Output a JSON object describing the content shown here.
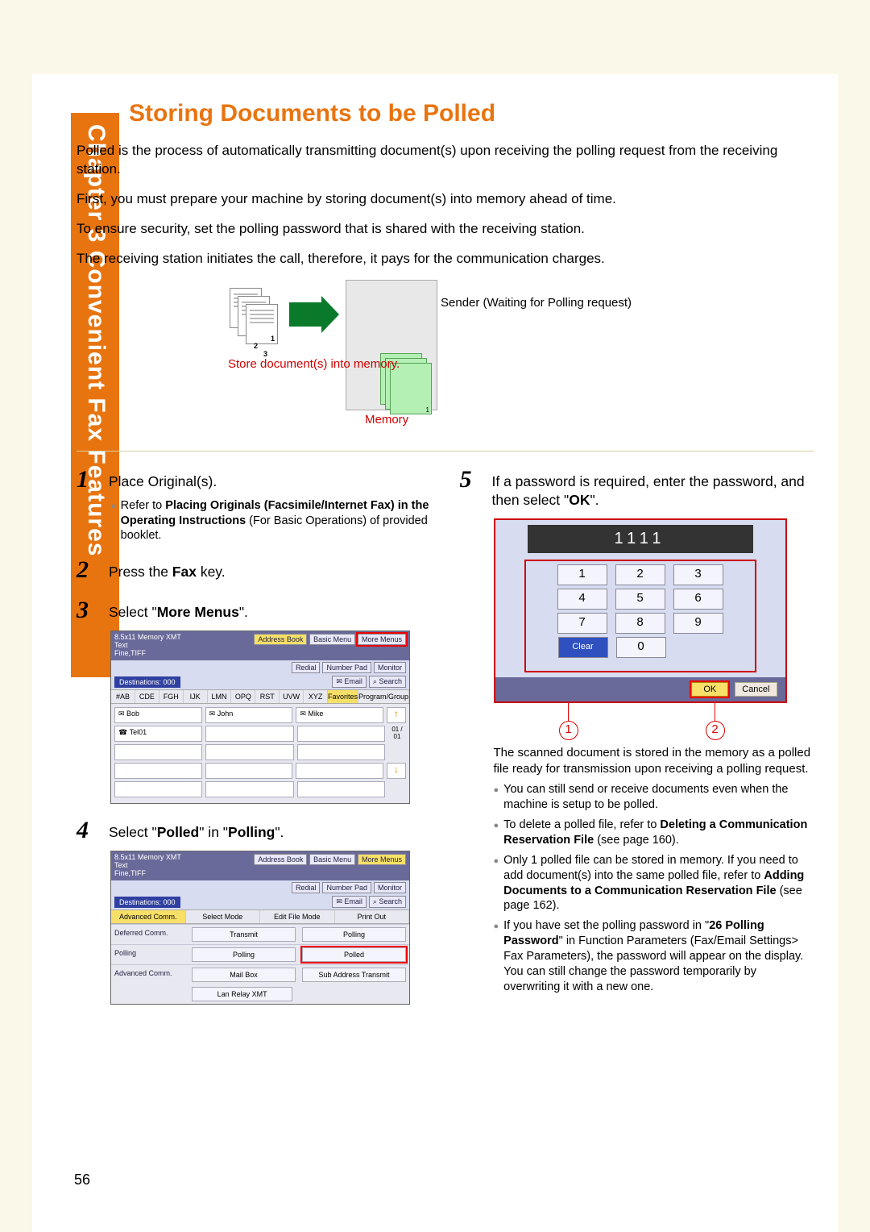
{
  "chapter": "Chapter 3   Convenient Fax Features",
  "title": "Storing Documents to be Polled",
  "intro": {
    "p1": "Polled is the process of automatically transmitting document(s) upon receiving the polling request from the receiving station.",
    "p2": "First, you must prepare your machine by storing document(s) into memory ahead of time.",
    "p3": "To ensure security, set the polling password that is shared with the receiving station.",
    "p4": "The receiving station initiates the call, therefore, it pays for the communication charges."
  },
  "diagram": {
    "store": "Store document(s) into memory.",
    "memory": "Memory",
    "sender": "Sender (Waiting for Polling request)",
    "nums": [
      "1",
      "2",
      "3"
    ]
  },
  "steps": {
    "s1": {
      "num": "1",
      "text": "Place Original(s).",
      "note_pre": "Refer to ",
      "note_bold1": "Placing Originals (Facsimile/Internet Fax) in the Operating Instructions",
      "note_post": " (For Basic Operations) of provided booklet."
    },
    "s2": {
      "num": "2",
      "text_pre": "Press the ",
      "text_bold": "Fax",
      "text_post": " key."
    },
    "s3": {
      "num": "3",
      "text_pre": "Select \"",
      "text_bold": "More Menus",
      "text_post": "\"."
    },
    "s4": {
      "num": "4",
      "text_pre": "Select \"",
      "text_b1": "Polled",
      "text_mid": "\" in \"",
      "text_b2": "Polling",
      "text_post": "\"."
    },
    "s5": {
      "num": "5",
      "text_pre": "If a password is required, enter the password, and then select \"",
      "text_bold": "OK",
      "text_post": "\"."
    }
  },
  "screenA": {
    "info1": "8.5x11    Memory XMT",
    "info2": "Text",
    "info3": "Fine,TIFF",
    "topbtns": [
      "Address Book",
      "Basic Menu",
      "More Menus"
    ],
    "row2": [
      "Redial",
      "Number Pad",
      "Monitor"
    ],
    "dest": "Destinations: 000",
    "row3": [
      "Email",
      "Search"
    ],
    "tabs": [
      "#AB",
      "CDE",
      "FGH",
      "IJK",
      "LMN",
      "OPQ",
      "RST",
      "UVW",
      "XYZ",
      "Favorites",
      "Program/Group"
    ],
    "names": [
      "Bob",
      "John",
      "Mike",
      "Tel01"
    ],
    "pager": "01 / 01"
  },
  "screenB": {
    "topbtns": [
      "Address Book",
      "Basic Menu",
      "More Menus"
    ],
    "row2": [
      "Redial",
      "Number Pad",
      "Monitor"
    ],
    "row3": [
      "Email",
      "Search"
    ],
    "dest": "Destinations: 000",
    "advtabs": [
      "Advanced Comm.",
      "Select Mode",
      "Edit File Mode",
      "Print Out"
    ],
    "rows": {
      "deferred": {
        "label": "Deferred Comm.",
        "b1": "Transmit",
        "b2": "Polling"
      },
      "polling": {
        "label": "Polling",
        "b1": "Polling",
        "b2": "Polled"
      },
      "advanced": {
        "label": "Advanced Comm.",
        "b1": "Mail Box",
        "b2": "Sub Address Transmit",
        "b3": "Lan Relay XMT"
      }
    }
  },
  "keypad": {
    "display": "1111",
    "keys": [
      [
        "1",
        "2",
        "3"
      ],
      [
        "4",
        "5",
        "6"
      ],
      [
        "7",
        "8",
        "9"
      ],
      [
        "Clear",
        "0"
      ]
    ],
    "ok": "OK",
    "cancel": "Cancel",
    "marks": [
      "1",
      "2"
    ]
  },
  "after": {
    "para": "The scanned document is stored in the memory as a polled file ready for transmission upon receiving a polling request.",
    "b1": "You can still send or receive documents even when the machine is setup to be polled.",
    "b2_pre": "To delete a polled file, refer to ",
    "b2_bold": "Deleting a Communication Reservation File",
    "b2_post": " (see page 160).",
    "b3_pre": "Only 1 polled file can be stored in memory. If you need to add document(s) into the same polled file, refer to ",
    "b3_bold": "Adding Documents to a Communication Reservation File",
    "b3_post": " (see page 162).",
    "b4_pre": "If you have set the polling password in \"",
    "b4_bold": "26 Polling Password",
    "b4_post": "\" in Function Parameters (Fax/Email Settings> Fax Parameters), the password will appear on the display. You can still change the password temporarily by overwriting it with a new one."
  },
  "page": "56"
}
